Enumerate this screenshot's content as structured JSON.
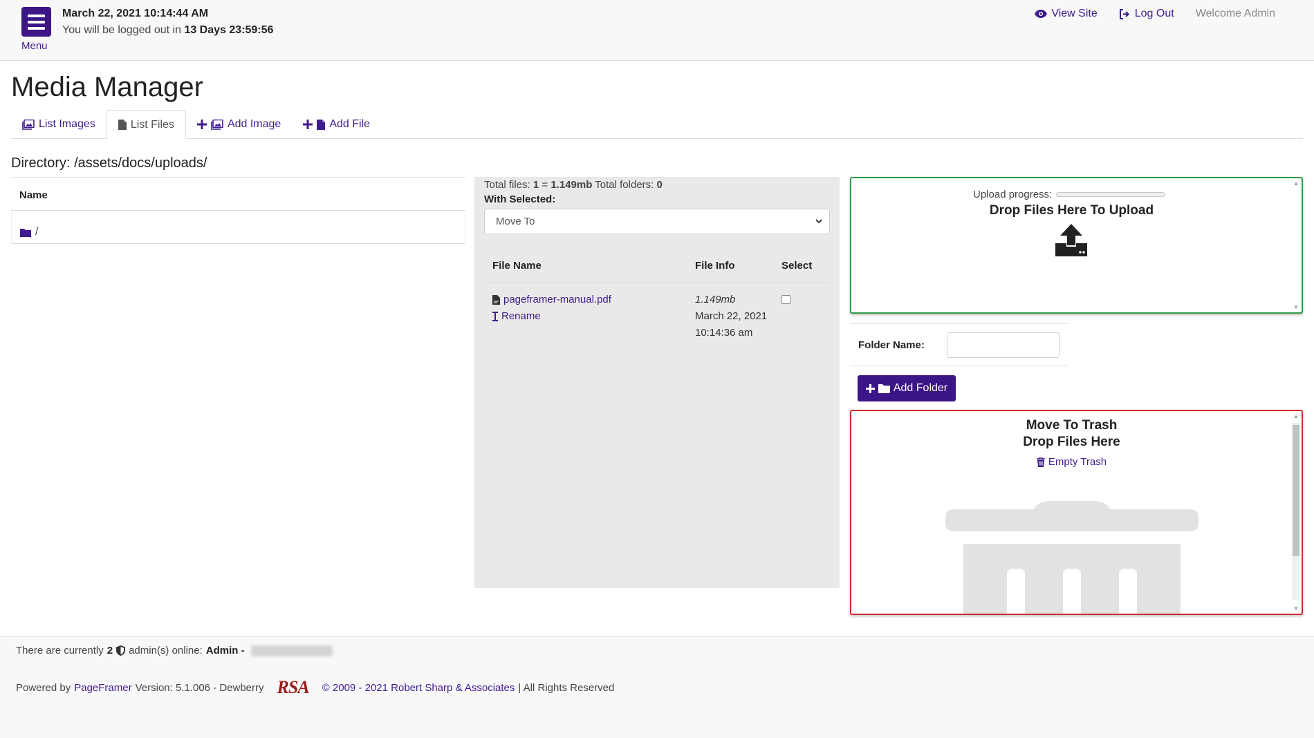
{
  "topbar": {
    "menu_label": "Menu",
    "datetime": "March 22, 2021 10:14:44 AM",
    "logout_prefix": "You will be logged out in",
    "logout_remaining": "13 Days 23:59:56",
    "view_site": "View Site",
    "log_out": "Log Out",
    "welcome": "Welcome Admin"
  },
  "page": {
    "title": "Media Manager",
    "tabs": [
      {
        "label": "List Images",
        "icon": "images-icon"
      },
      {
        "label": "List Files",
        "icon": "file-icon",
        "active": true
      },
      {
        "label": "Add Image",
        "icon": "add-image-icon"
      },
      {
        "label": "Add File",
        "icon": "add-file-icon"
      }
    ],
    "directory": "Directory: /assets/docs/uploads/"
  },
  "folders": {
    "header": "Name",
    "items": [
      {
        "name": "/"
      }
    ]
  },
  "files": {
    "total_files_label": "Total files:",
    "total_files": "1",
    "equals": "=",
    "total_size": "1.149mb",
    "total_folders_label": "Total folders:",
    "total_folders": "0",
    "with_selected": "With Selected:",
    "move_to": "Move To",
    "headers": {
      "name": "File Name",
      "info": "File Info",
      "select": "Select"
    },
    "rows": [
      {
        "name": "pageframer-manual.pdf",
        "rename": "Rename",
        "size": "1.149mb",
        "date": "March 22, 2021 10:14:36 am"
      }
    ]
  },
  "upload": {
    "progress_label": "Upload progress:",
    "progress_value": 0,
    "title": "Drop Files Here To Upload"
  },
  "folder_form": {
    "label": "Folder Name:",
    "value": "",
    "button": "Add Folder"
  },
  "trash": {
    "title_line1": "Move To Trash",
    "title_line2": "Drop Files Here",
    "empty": "Empty Trash"
  },
  "footer": {
    "online_prefix": "There are currently",
    "online_count": "2",
    "online_suffix": "admin(s) online:",
    "online_admin": "Admin -",
    "powered_by": "Powered by",
    "pageframer": "PageFramer",
    "version": "Version: 5.1.006 - Dewberry",
    "logo_text": "RSA",
    "copyright": "© 2009 - 2021 Robert Sharp & Associates",
    "rights": "| All Rights Reserved"
  },
  "colors": {
    "brand": "#3c1586",
    "upload_border": "#2e9a45",
    "trash_border": "#d12b2b"
  }
}
